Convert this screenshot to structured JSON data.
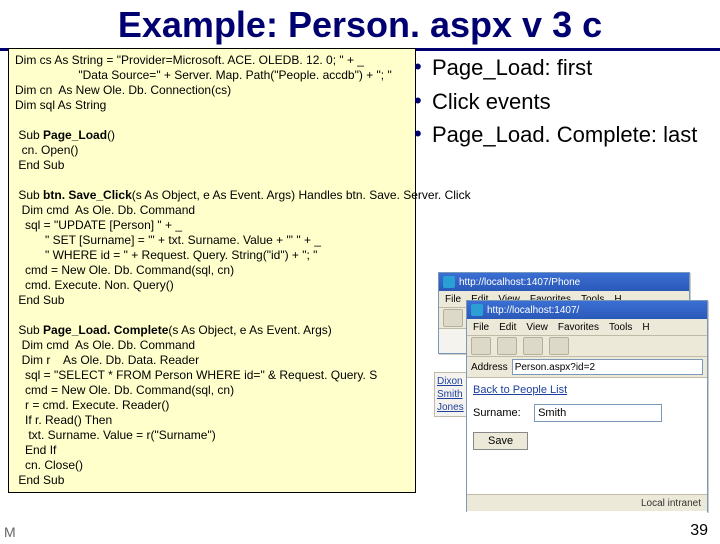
{
  "title": "Example: Person. aspx v 3 c",
  "code": "Dim cs As String = \"Provider=Microsoft. ACE. OLEDB. 12. 0; \" + _\n                   \"Data Source=\" + Server. Map. Path(\"People. accdb\") + \"; \"\nDim cn  As New Ole. Db. Connection(cs)\nDim sql As String\n\n Sub <b>Page_Load</b>()\n  cn. Open()\n End Sub\n\n Sub <b>btn. Save_Click</b>(s As Object, e As Event. Args) Handles btn. Save. Server. Click\n  Dim cmd  As Ole. Db. Command\n   sql = \"UPDATE [Person] \" + _\n         \" SET [Surname] = '\" + txt. Surname. Value + \"' \" + _\n         \" WHERE id = \" + Request. Query. String(\"id\") + \"; \"\n   cmd = New Ole. Db. Command(sql, cn)\n   cmd. Execute. Non. Query()\n End Sub\n\n Sub <b>Page_Load. Complete</b>(s As Object, e As Event. Args)\n  Dim cmd  As Ole. Db. Command\n  Dim r    As Ole. Db. Data. Reader\n   sql = \"SELECT * FROM Person WHERE id=\" & Request. Query. S\n   cmd = New Ole. Db. Command(sql, cn)\n   r = cmd. Execute. Reader()\n   If r. Read() Then\n    txt. Surname. Value = r(\"Surname\")\n   End If\n   cn. Close()\n End Sub",
  "bullets": [
    "Page_Load: first",
    "Click events",
    "Page_Load. Complete: last"
  ],
  "browser": {
    "url1": "http://localhost:1407/Phone",
    "url2": "http://localhost:1407/",
    "menus": [
      "File",
      "Edit",
      "View",
      "Favorites",
      "Tools",
      "H"
    ],
    "address_label": "Address",
    "address_value": "Person.aspx?id=2",
    "back_link": "Back to People List",
    "surname_label": "Surname:",
    "surname_value": "Smith",
    "save_label": "Save",
    "status": "Local intranet",
    "names": [
      "Dixon",
      "Smith",
      "Jones"
    ]
  },
  "footer": {
    "left": "M",
    "page": "39"
  }
}
